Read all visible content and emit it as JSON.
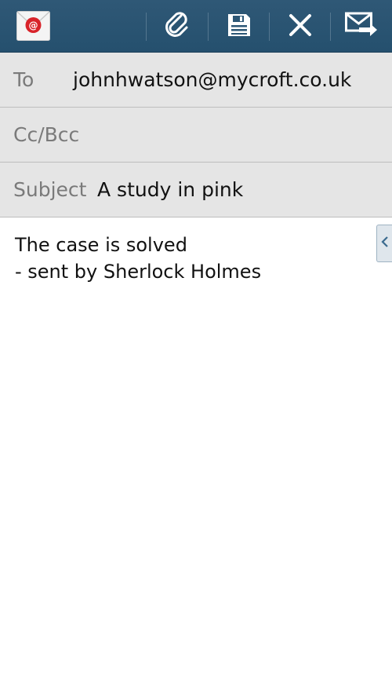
{
  "toolbar": {
    "app_icon": "email-app-icon",
    "buttons": [
      {
        "name": "attach-button",
        "icon": "paperclip-icon"
      },
      {
        "name": "save-button",
        "icon": "save-icon"
      },
      {
        "name": "discard-button",
        "icon": "close-icon"
      },
      {
        "name": "send-button",
        "icon": "send-mail-icon"
      }
    ],
    "colors": {
      "background": "#2A5472",
      "icon": "#FFFFFF"
    }
  },
  "compose": {
    "to": {
      "label": "To",
      "value": "johnhwatson@mycroft.co.uk"
    },
    "cc_bcc": {
      "label": "Cc/Bcc",
      "value": ""
    },
    "subject": {
      "label": "Subject",
      "value": "A study in pink"
    },
    "body_lines": [
      "The case is solved",
      "- sent by Sherlock Holmes"
    ]
  },
  "side_handle": {
    "icon": "chevron-left-icon"
  }
}
